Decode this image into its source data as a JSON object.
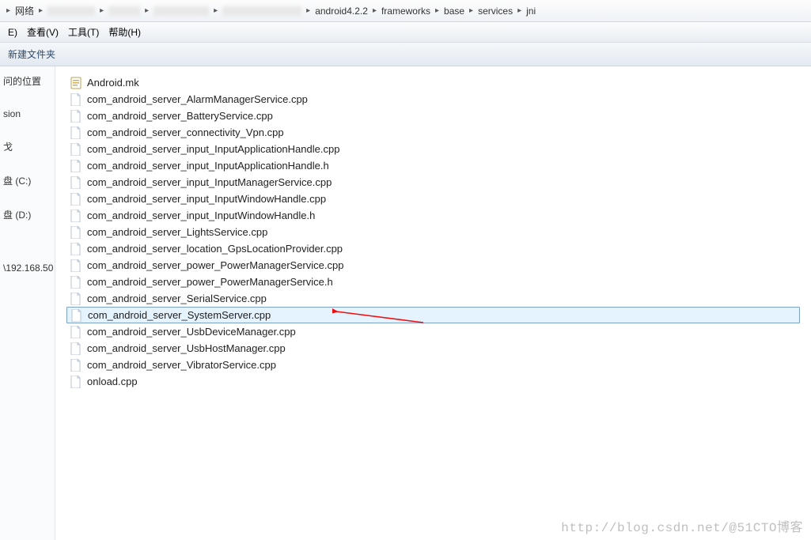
{
  "breadcrumb": {
    "root": "网络",
    "items": [
      "android4.2.2",
      "frameworks",
      "base",
      "services",
      "jni"
    ]
  },
  "menubar": {
    "edit": "E)",
    "view": "查看(V)",
    "tools": "工具(T)",
    "help": "帮助(H)"
  },
  "toolbar": {
    "newfolder": "新建文件夹"
  },
  "sidebar": {
    "recent": "问的位置",
    "sion": "sion",
    "unk": "戈",
    "drivec": "盘 (C:)",
    "drived": "盘 (D:)",
    "ip": "\\192.168.50"
  },
  "files": [
    {
      "name": "Android.mk",
      "icon": "mk",
      "selected": false
    },
    {
      "name": "com_android_server_AlarmManagerService.cpp",
      "icon": "page",
      "selected": false
    },
    {
      "name": "com_android_server_BatteryService.cpp",
      "icon": "page",
      "selected": false
    },
    {
      "name": "com_android_server_connectivity_Vpn.cpp",
      "icon": "page",
      "selected": false
    },
    {
      "name": "com_android_server_input_InputApplicationHandle.cpp",
      "icon": "page",
      "selected": false
    },
    {
      "name": "com_android_server_input_InputApplicationHandle.h",
      "icon": "page",
      "selected": false
    },
    {
      "name": "com_android_server_input_InputManagerService.cpp",
      "icon": "page",
      "selected": false
    },
    {
      "name": "com_android_server_input_InputWindowHandle.cpp",
      "icon": "page",
      "selected": false
    },
    {
      "name": "com_android_server_input_InputWindowHandle.h",
      "icon": "page",
      "selected": false
    },
    {
      "name": "com_android_server_LightsService.cpp",
      "icon": "page",
      "selected": false
    },
    {
      "name": "com_android_server_location_GpsLocationProvider.cpp",
      "icon": "page",
      "selected": false
    },
    {
      "name": "com_android_server_power_PowerManagerService.cpp",
      "icon": "page",
      "selected": false
    },
    {
      "name": "com_android_server_power_PowerManagerService.h",
      "icon": "page",
      "selected": false
    },
    {
      "name": "com_android_server_SerialService.cpp",
      "icon": "page",
      "selected": false
    },
    {
      "name": "com_android_server_SystemServer.cpp",
      "icon": "page",
      "selected": true
    },
    {
      "name": "com_android_server_UsbDeviceManager.cpp",
      "icon": "page",
      "selected": false
    },
    {
      "name": "com_android_server_UsbHostManager.cpp",
      "icon": "page",
      "selected": false
    },
    {
      "name": "com_android_server_VibratorService.cpp",
      "icon": "page",
      "selected": false
    },
    {
      "name": "onload.cpp",
      "icon": "page",
      "selected": false
    }
  ],
  "watermark": "http://blog.csdn.net/@51CTO博客"
}
